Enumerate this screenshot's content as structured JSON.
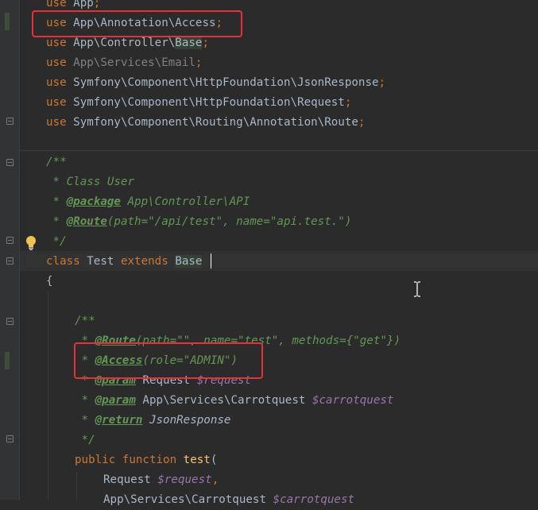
{
  "editor": {
    "language": "PHP",
    "bulb_icon": "lightbulb-icon",
    "mouse_icon": "text-cursor-icon",
    "highlight_color": "#e8303a",
    "lines": {
      "l0_kw": "use",
      "l0_ns": " App",
      "l0_end": ";",
      "l1_kw": "use",
      "l1_ns": " App\\Annotation\\Access",
      "l1_end": ";",
      "l2_kw": "use",
      "l2_ns": " App\\Controller\\",
      "l2_base": "Base",
      "l2_end": ";",
      "l3_kw": "use",
      "l3_ns": " App\\Services\\Email",
      "l3_end": ";",
      "l4_kw": "use",
      "l4_ns": " Symfony\\Component\\HttpFoundation\\JsonResponse",
      "l4_end": ";",
      "l5_kw": "use",
      "l5_ns": " Symfony\\Component\\HttpFoundation\\Request",
      "l5_end": ";",
      "l6_kw": "use",
      "l6_ns": " Symfony\\Component\\Routing\\Annotation\\Route",
      "l6_end": ";",
      "d0": "/**",
      "d1": " * Class User",
      "d2_pre": " * ",
      "d2_tag": "@package",
      "d2_rest": " App\\Controller\\API",
      "d3_pre": " * ",
      "d3_tag": "@Route",
      "d3_rest": "(path=\"/api/test\", name=\"api.test.\")",
      "d4": " */",
      "c_kw1": "class",
      "c_name": " Test ",
      "c_kw2": "extends",
      "c_sp": " ",
      "c_base": "Base",
      "brace": "{",
      "m0": "/**",
      "m1_pre": " * ",
      "m1_tag": "@Route",
      "m1_rest": "(path=\"\", name=\"test\", methods={\"get\"})",
      "m2_pre": " * ",
      "m2_tag": "@Access",
      "m2_rest": "(role=\"ADMIN\")",
      "m3_pre": " * ",
      "m3_tag": "@param",
      "m3_type": " Request ",
      "m3_var": "$request",
      "m4_pre": " * ",
      "m4_tag": "@param",
      "m4_type": " App\\Services\\Carrotquest ",
      "m4_var": "$carrotquest",
      "m5_pre": " * ",
      "m5_tag": "@return",
      "m5_type": " JsonResponse",
      "m6": " */",
      "f_kw": "public function",
      "f_sp": " ",
      "f_name": "test",
      "f_paren": "(",
      "p1_type": "Request ",
      "p1_var": "$request",
      "p1_end": ",",
      "p2_type": "App\\Services\\Carrotquest ",
      "p2_var": "$carrotquest"
    }
  }
}
